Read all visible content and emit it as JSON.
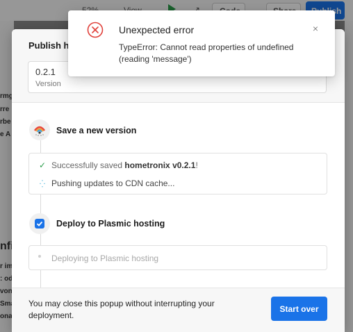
{
  "app_toolbar": {
    "zoom": "52%",
    "view_label": "View ⌄",
    "code_label": "Code",
    "share_label": "Share",
    "publish_label": "Publish"
  },
  "left_panel_fragments": [
    "rmg",
    "rre",
    "rbe",
    "e A",
    "nfi",
    "r im",
    ": od",
    "von",
    "Sma",
    "ona"
  ],
  "toast": {
    "icon": "error-circle-icon",
    "title": "Unexpected error",
    "message": "TypeError: Cannot read properties of undefined (reading 'message')",
    "close_glyph": "×",
    "error_color": "#e0403a"
  },
  "modal": {
    "title": "Publish ho",
    "version_value": "0.2.1",
    "version_label": "Version",
    "step1": {
      "title": "Save a new version",
      "icon": "plasmic-logo-icon",
      "log": {
        "saved_prefix": "Successfully saved ",
        "saved_name": "hometronix v0.2.1",
        "saved_suffix": "!",
        "pushing": "Pushing updates to CDN cache..."
      }
    },
    "step2": {
      "title": "Deploy to Plasmic hosting",
      "checked": true,
      "status": "Deploying to Plasmic hosting"
    },
    "footer": {
      "note": "You may close this popup without interrupting your deployment.",
      "button_label": "Start over"
    }
  },
  "colors": {
    "accent": "#1a73e8",
    "success": "#2a9d4a",
    "spinner": "#2aa7d6"
  }
}
